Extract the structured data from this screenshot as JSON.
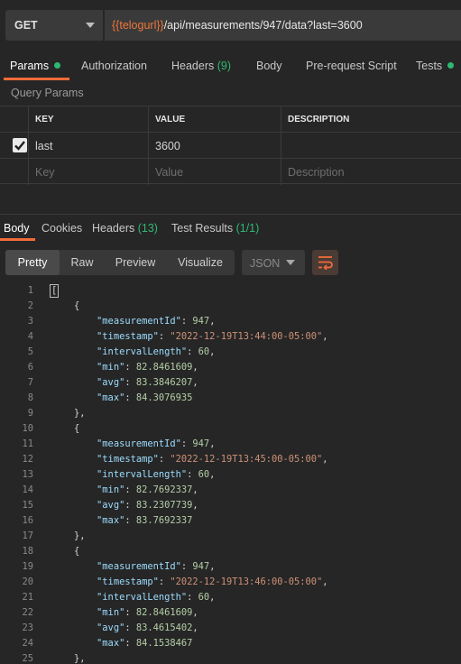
{
  "request": {
    "method": "GET",
    "url_var": "{{telogurl}}",
    "url_path": "/api/measurements/947/data?last=3600"
  },
  "request_tabs": [
    {
      "label": "Params",
      "badge": "",
      "dot": true,
      "active": true
    },
    {
      "label": "Authorization",
      "badge": "",
      "dot": false,
      "active": false
    },
    {
      "label": "Headers",
      "badge": "(9)",
      "dot": false,
      "active": false
    },
    {
      "label": "Body",
      "badge": "",
      "dot": false,
      "active": false
    },
    {
      "label": "Pre-request Script",
      "badge": "",
      "dot": false,
      "active": false
    },
    {
      "label": "Tests",
      "badge": "",
      "dot": true,
      "active": false
    }
  ],
  "query_params": {
    "title": "Query Params",
    "headers": [
      "KEY",
      "VALUE",
      "DESCRIPTION"
    ],
    "rows": [
      {
        "checked": true,
        "key": "last",
        "value": "3600",
        "description": ""
      }
    ],
    "placeholder": {
      "key": "Key",
      "value": "Value",
      "description": "Description"
    }
  },
  "response_tabs": [
    {
      "label": "Body",
      "badge": "",
      "active": true
    },
    {
      "label": "Cookies",
      "badge": "",
      "active": false
    },
    {
      "label": "Headers",
      "badge": "(13)",
      "active": false
    },
    {
      "label": "Test Results",
      "badge": "(1/1)",
      "active": false
    }
  ],
  "view_modes": [
    "Pretty",
    "Raw",
    "Preview",
    "Visualize"
  ],
  "active_view": "Pretty",
  "format": "JSON",
  "code_lines": [
    {
      "n": "1",
      "t": "["
    },
    {
      "n": "2",
      "t": "    {"
    },
    {
      "n": "3",
      "t": "        \"measurementId\": 947,"
    },
    {
      "n": "4",
      "t": "        \"timestamp\": \"2022-12-19T13:44:00-05:00\","
    },
    {
      "n": "5",
      "t": "        \"intervalLength\": 60,"
    },
    {
      "n": "6",
      "t": "        \"min\": 82.8461609,"
    },
    {
      "n": "7",
      "t": "        \"avg\": 83.3846207,"
    },
    {
      "n": "8",
      "t": "        \"max\": 84.3076935"
    },
    {
      "n": "9",
      "t": "    },"
    },
    {
      "n": "10",
      "t": "    {"
    },
    {
      "n": "11",
      "t": "        \"measurementId\": 947,"
    },
    {
      "n": "12",
      "t": "        \"timestamp\": \"2022-12-19T13:45:00-05:00\","
    },
    {
      "n": "13",
      "t": "        \"intervalLength\": 60,"
    },
    {
      "n": "14",
      "t": "        \"min\": 82.7692337,"
    },
    {
      "n": "15",
      "t": "        \"avg\": 83.2307739,"
    },
    {
      "n": "16",
      "t": "        \"max\": 83.7692337"
    },
    {
      "n": "17",
      "t": "    },"
    },
    {
      "n": "18",
      "t": "    {"
    },
    {
      "n": "19",
      "t": "        \"measurementId\": 947,"
    },
    {
      "n": "20",
      "t": "        \"timestamp\": \"2022-12-19T13:46:00-05:00\","
    },
    {
      "n": "21",
      "t": "        \"intervalLength\": 60,"
    },
    {
      "n": "22",
      "t": "        \"min\": 82.8461609,"
    },
    {
      "n": "23",
      "t": "        \"avg\": 83.4615402,"
    },
    {
      "n": "24",
      "t": "        \"max\": 84.1538467"
    },
    {
      "n": "25",
      "t": "    },"
    }
  ],
  "colors": {
    "accent": "#f26b3a",
    "green": "#2eb873",
    "url_variable": "#f0773a"
  }
}
